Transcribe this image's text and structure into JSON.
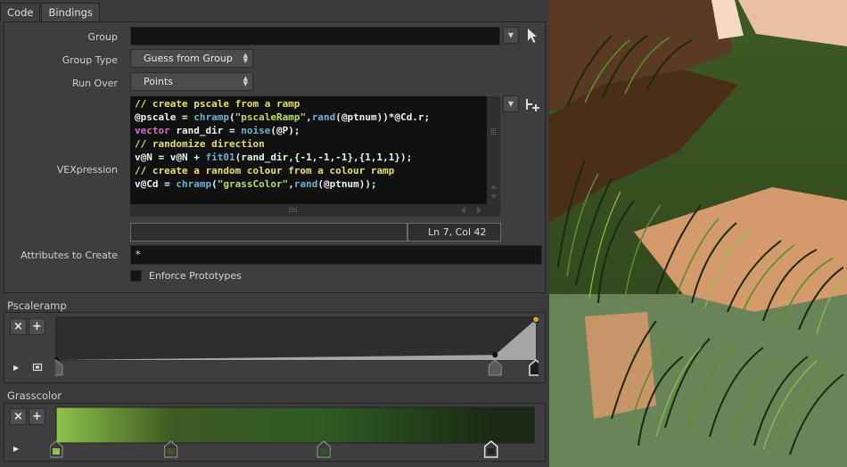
{
  "tabs": [
    {
      "label": "Code",
      "active": true
    },
    {
      "label": "Bindings",
      "active": false
    }
  ],
  "params": {
    "group_label": "Group",
    "group_value": "",
    "group_type_label": "Group Type",
    "group_type_value": "Guess from Group",
    "run_over_label": "Run Over",
    "run_over_value": "Points",
    "vex_label": "VEXpression",
    "attributes_label": "Attributes to Create",
    "attributes_value": "*",
    "enforce_label": "Enforce Prototypes",
    "enforce_checked": false
  },
  "code_lines": [
    [
      {
        "t": "// create pscale from a ramp",
        "c": "cm"
      }
    ],
    [
      {
        "t": "@pscale = ",
        "c": ""
      },
      {
        "t": "chramp",
        "c": "fn"
      },
      {
        "t": "(",
        "c": ""
      },
      {
        "t": "\"pscaleRamp\"",
        "c": "st"
      },
      {
        "t": ",",
        "c": ""
      },
      {
        "t": "rand",
        "c": "fn"
      },
      {
        "t": "(@ptnum))*@Cd.r;",
        "c": ""
      }
    ],
    [
      {
        "t": "vector",
        "c": "kw"
      },
      {
        "t": " rand_dir = ",
        "c": ""
      },
      {
        "t": "noise",
        "c": "fn"
      },
      {
        "t": "(@P);",
        "c": ""
      }
    ],
    [
      {
        "t": "// randomize direction",
        "c": "cm"
      }
    ],
    [
      {
        "t": "v@N = v@N + ",
        "c": ""
      },
      {
        "t": "fit01",
        "c": "fn"
      },
      {
        "t": "(rand_dir,{-1,-1,-1},{1,1,1});",
        "c": ""
      }
    ],
    [
      {
        "t": "// create a random colour from a colour ramp",
        "c": "cm"
      }
    ],
    [
      {
        "t": "v@Cd = ",
        "c": ""
      },
      {
        "t": "chramp",
        "c": "fn"
      },
      {
        "t": "(",
        "c": ""
      },
      {
        "t": "\"grassColor\"",
        "c": "st"
      },
      {
        "t": ",",
        "c": ""
      },
      {
        "t": "rand",
        "c": "fn"
      },
      {
        "t": "(@ptnum));",
        "c": ""
      }
    ]
  ],
  "editor_status": "Ln 7, Col 42",
  "pscale_ramp": {
    "title": "Pscaleramp",
    "keys": [
      {
        "pos": 0.0,
        "value": 0.0
      },
      {
        "pos": 0.915,
        "value": 0.12
      },
      {
        "pos": 1.0,
        "value": 0.95
      }
    ],
    "colors": {
      "fill": "#a6a6a6",
      "bg": "#2e2e2e",
      "selected": "#e0a040"
    }
  },
  "grass_ramp": {
    "title": "Grasscolor",
    "keys": [
      {
        "pos": 0.0,
        "color": "#8cc34a"
      },
      {
        "pos": 0.24,
        "color": "#3f5a22"
      },
      {
        "pos": 0.56,
        "color": "#2d5b24"
      },
      {
        "pos": 0.91,
        "color": "#1b2a14"
      }
    ]
  },
  "buttons": {
    "delete": "×",
    "add": "+"
  }
}
